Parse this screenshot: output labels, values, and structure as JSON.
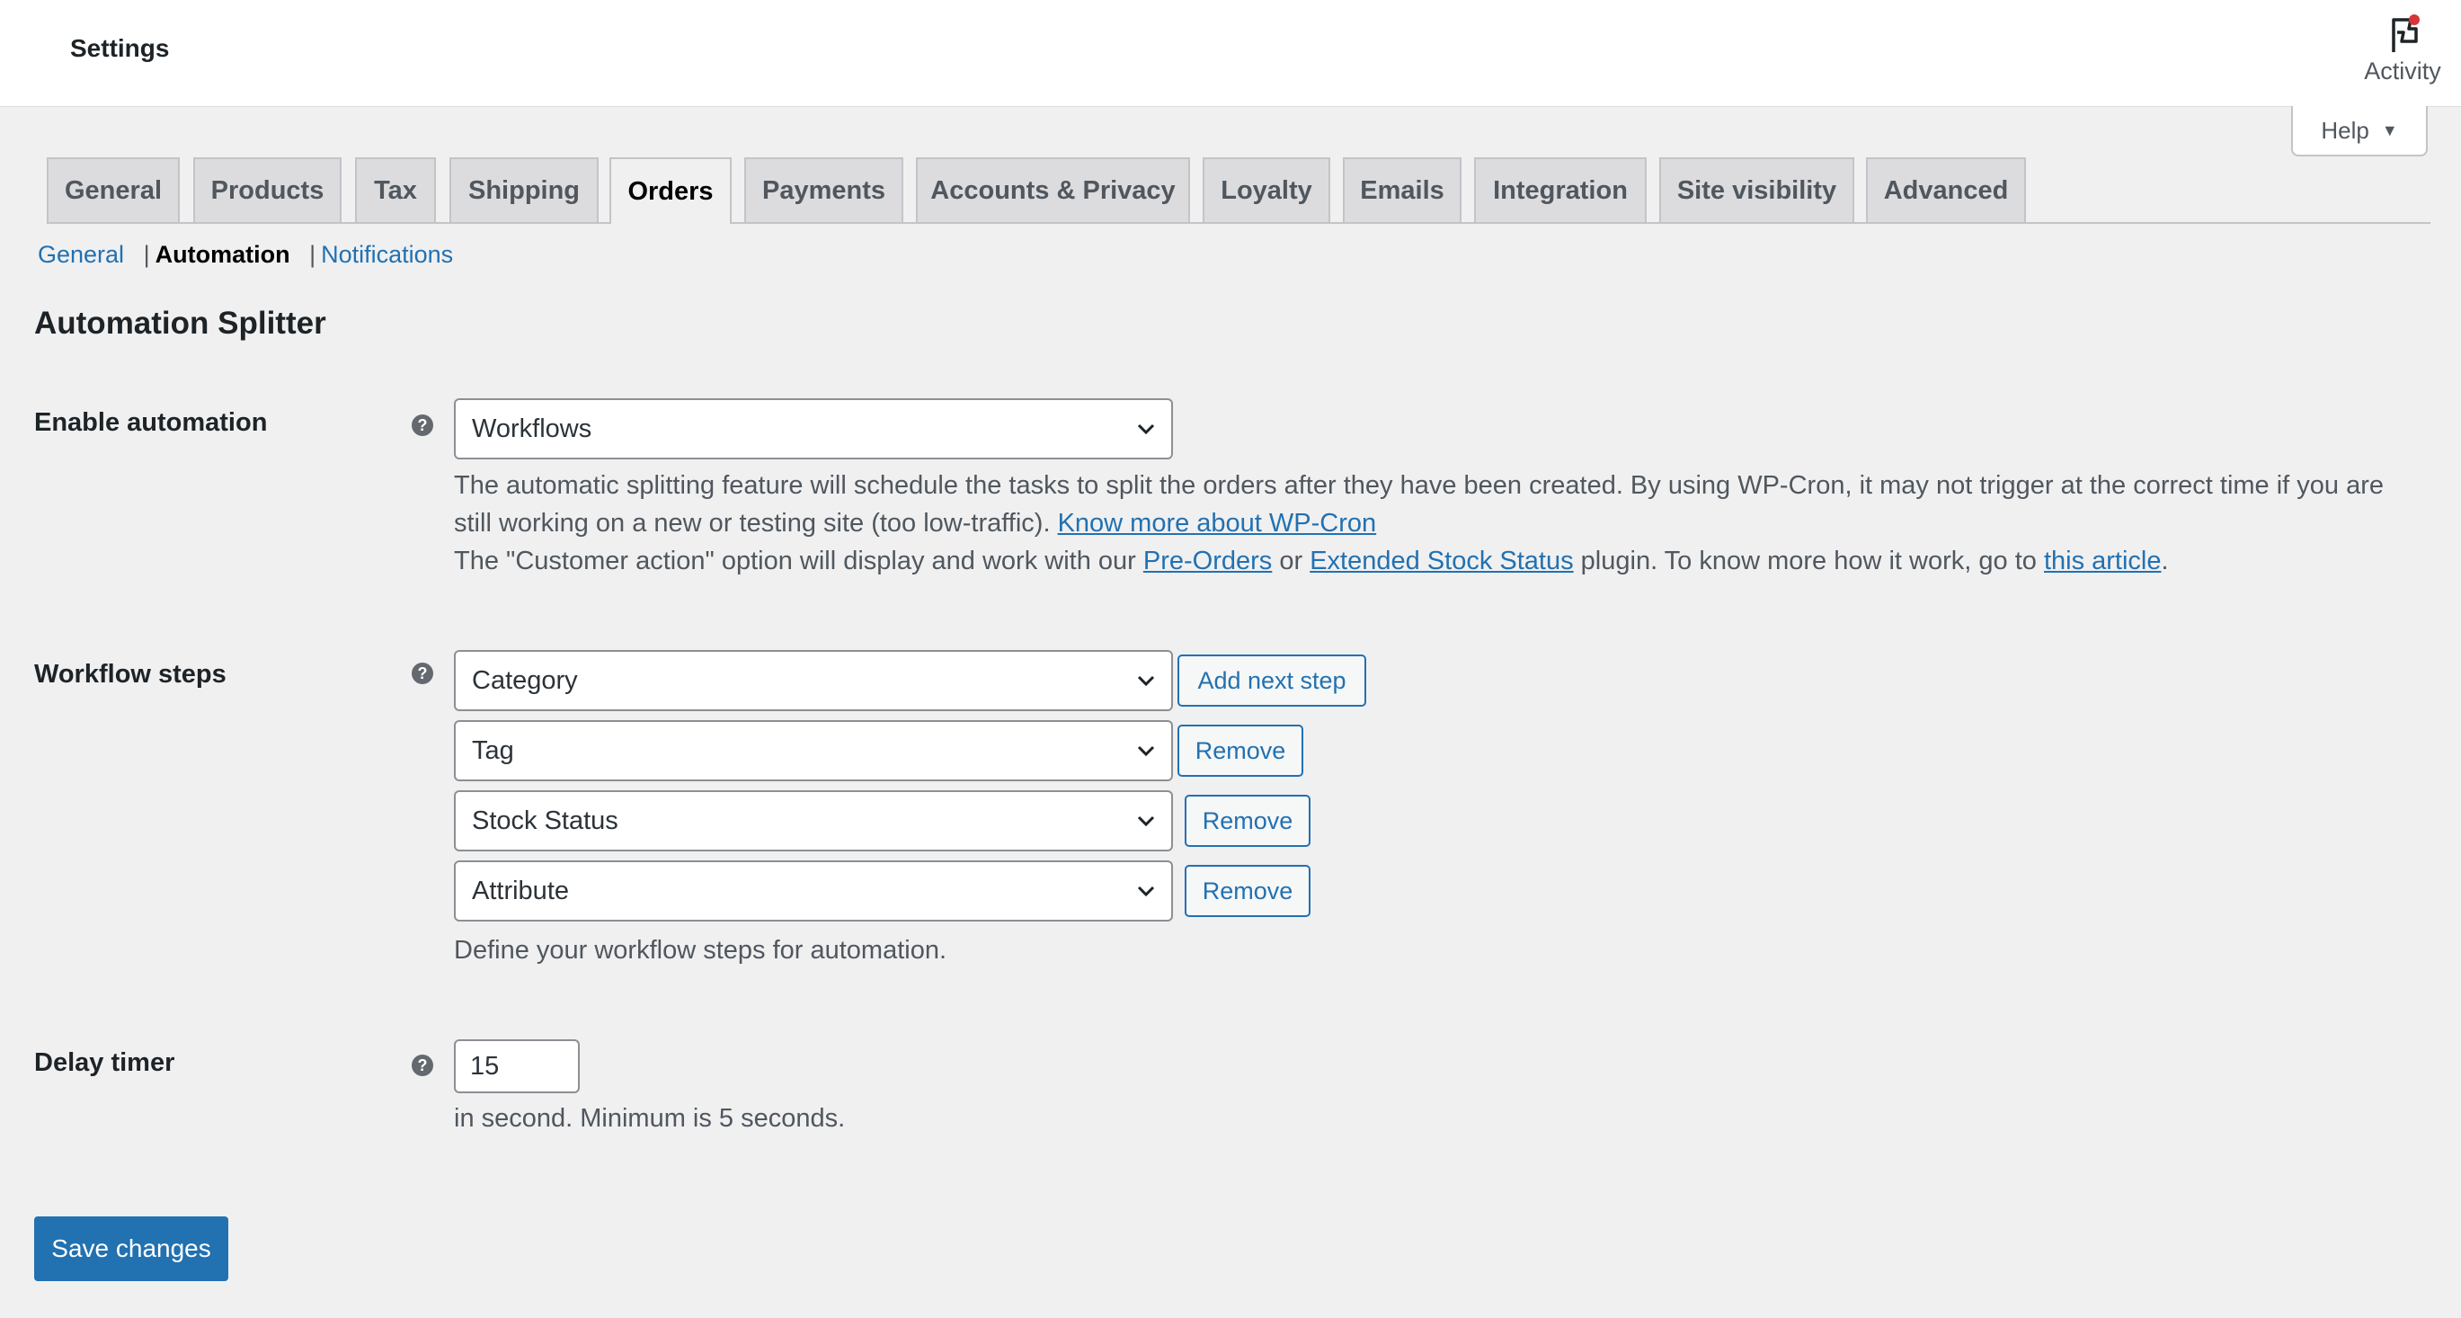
{
  "header": {
    "title": "Settings",
    "activity_label": "Activity",
    "help_label": "Help",
    "help_arrow": "▼"
  },
  "tabs": [
    {
      "label": "General"
    },
    {
      "label": "Products"
    },
    {
      "label": "Tax"
    },
    {
      "label": "Shipping"
    },
    {
      "label": "Orders",
      "active": true
    },
    {
      "label": "Payments"
    },
    {
      "label": "Accounts & Privacy"
    },
    {
      "label": "Loyalty"
    },
    {
      "label": "Emails"
    },
    {
      "label": "Integration"
    },
    {
      "label": "Site visibility"
    },
    {
      "label": "Advanced"
    }
  ],
  "subnav": {
    "items": [
      "General",
      "Automation",
      "Notifications"
    ],
    "current": "Automation",
    "separator": "|"
  },
  "section_title": "Automation Splitter",
  "help_tip_glyph": "?",
  "enable_automation": {
    "label": "Enable automation",
    "value": "Workflows",
    "desc": {
      "line1": "The automatic splitting feature will schedule the tasks to split the orders after they have been created. By using WP-Cron, it may not trigger at the correct time if you are",
      "line2_text": "still working on a new or testing site (too low-traffic). ",
      "line2_link": "Know more about WP-Cron",
      "line3_a": "The \"Customer action\" option will display and work with our ",
      "link_preorders": "Pre-Orders",
      "line3_b": " or ",
      "link_stock": "Extended Stock Status",
      "line3_c": " plugin. To know more how it work, go to ",
      "link_article": "this article",
      "line3_d": "."
    }
  },
  "workflow_steps": {
    "label": "Workflow steps",
    "steps": [
      {
        "value": "Category",
        "button": "Add next step"
      },
      {
        "value": "Tag",
        "button": "Remove"
      },
      {
        "value": "Stock Status",
        "button": "Remove"
      },
      {
        "value": "Attribute",
        "button": "Remove"
      }
    ],
    "desc": "Define your workflow steps for automation."
  },
  "delay_timer": {
    "label": "Delay timer",
    "value": "15",
    "desc": "in second. Minimum is 5 seconds."
  },
  "save_label": "Save changes",
  "colors": {
    "accent": "#2271b1",
    "background": "#f0f0f1",
    "notification_dot": "#d63638"
  }
}
